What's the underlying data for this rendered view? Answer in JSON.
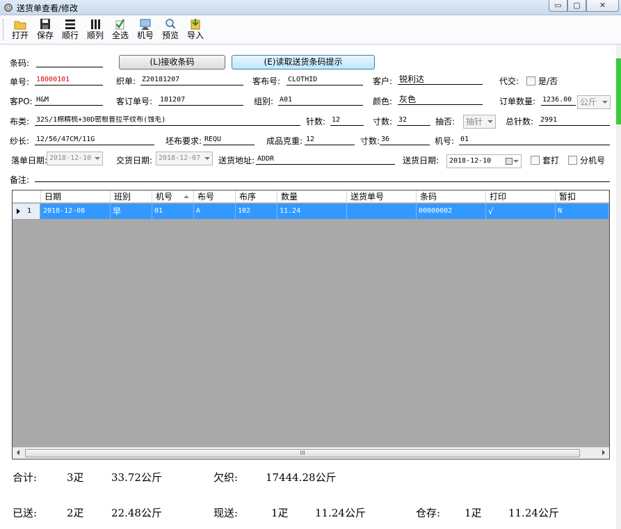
{
  "window": {
    "title": "送货单查看/修改",
    "min": "▭",
    "max": "▢",
    "close": "✕"
  },
  "toolbar": [
    {
      "name": "open",
      "label": "打开",
      "icon": "folder-icon"
    },
    {
      "name": "save",
      "label": "保存",
      "icon": "save-icon"
    },
    {
      "name": "row-order",
      "label": "顺行",
      "icon": "rows-icon"
    },
    {
      "name": "col-order",
      "label": "顺列",
      "icon": "columns-icon"
    },
    {
      "name": "select-all",
      "label": "全选",
      "icon": "check-icon"
    },
    {
      "name": "machine",
      "label": "机号",
      "icon": "monitor-icon"
    },
    {
      "name": "preview",
      "label": "预览",
      "icon": "magnifier-icon"
    },
    {
      "name": "import",
      "label": "导入",
      "icon": "import-icon"
    }
  ],
  "form": {
    "barcode_label": "条码:",
    "barcode_value": "",
    "receive_btn": "(L)接收条码",
    "read_btn": "(E)读取送货条码提示",
    "order_no_label": "单号:",
    "order_no": "18000101",
    "weave_label": "织单:",
    "weave": "Z20181207",
    "cust_cloth_label": "客布号:",
    "cust_cloth": "CLOTHID",
    "customer_label": "客户:",
    "customer": "锐利达",
    "proxy_label": "代交:",
    "proxy_check": "是/否",
    "po_label": "客PO:",
    "po": "H&M",
    "cust_order_label": "客订单号:",
    "cust_order": "181207",
    "group_label": "组别:",
    "group": "A01",
    "color_label": "颜色:",
    "color": "灰色",
    "qty_label": "订单数量:",
    "qty": "1236.00",
    "qty_unit": "公斤",
    "fabric_label": "布类:",
    "fabric": "32S/1棉精梳+30D密根普拉平纹布(蚀毛)",
    "needles_label": "针数:",
    "needles": "12",
    "inch_label": "寸数:",
    "inch": "32",
    "draw_label": "抽否:",
    "draw": "抽针",
    "total_needles_label": "总针数:",
    "total_needles": "2991",
    "yarn_label": "纱长:",
    "yarn": "12/56/47CM/11G",
    "defect_label": "坯布要求:",
    "defect": "REQU",
    "weight_label": "成品克重:",
    "weight": "12",
    "inch2_label": "寸数:",
    "inch2": "36",
    "machine_label": "机号:",
    "machine": "01",
    "drop_date_label": "落单日期:",
    "drop_date": "2018-12-10",
    "deliver_date_label": "交货日期:",
    "deliver_date": "2018-12-07",
    "address_label": "送货地址:",
    "address": "ADDR",
    "ship_date_label": "送货日期:",
    "ship_date": "2018-12-10",
    "suite_label": "套打",
    "split_label": "分机号",
    "note_label": "备注:",
    "note": ""
  },
  "grid": {
    "columns": [
      "日期",
      "班别",
      "机号",
      "布号",
      "布序",
      "数量",
      "送货单号",
      "条码",
      "打印",
      "暂扣"
    ],
    "rows": [
      {
        "no": "1",
        "cells": [
          "2018-12-08",
          "早",
          "01",
          "A",
          "102",
          "11.24",
          "",
          "00000002",
          "√",
          "N"
        ]
      }
    ],
    "scroll_grip": "III"
  },
  "summary": {
    "total_label": "合计:",
    "total_pieces": "3疋",
    "total_weight": "33.72公斤",
    "owe_label": "欠织:",
    "owe_weight": "17444.28公斤",
    "sent_label": "已送:",
    "sent_pieces": "2疋",
    "sent_weight": "22.48公斤",
    "now_label": "现送:",
    "now_pieces": "1疋",
    "now_weight": "11.24公斤",
    "stock_label": "仓存:",
    "stock_pieces": "1疋",
    "stock_weight": "11.24公斤"
  }
}
